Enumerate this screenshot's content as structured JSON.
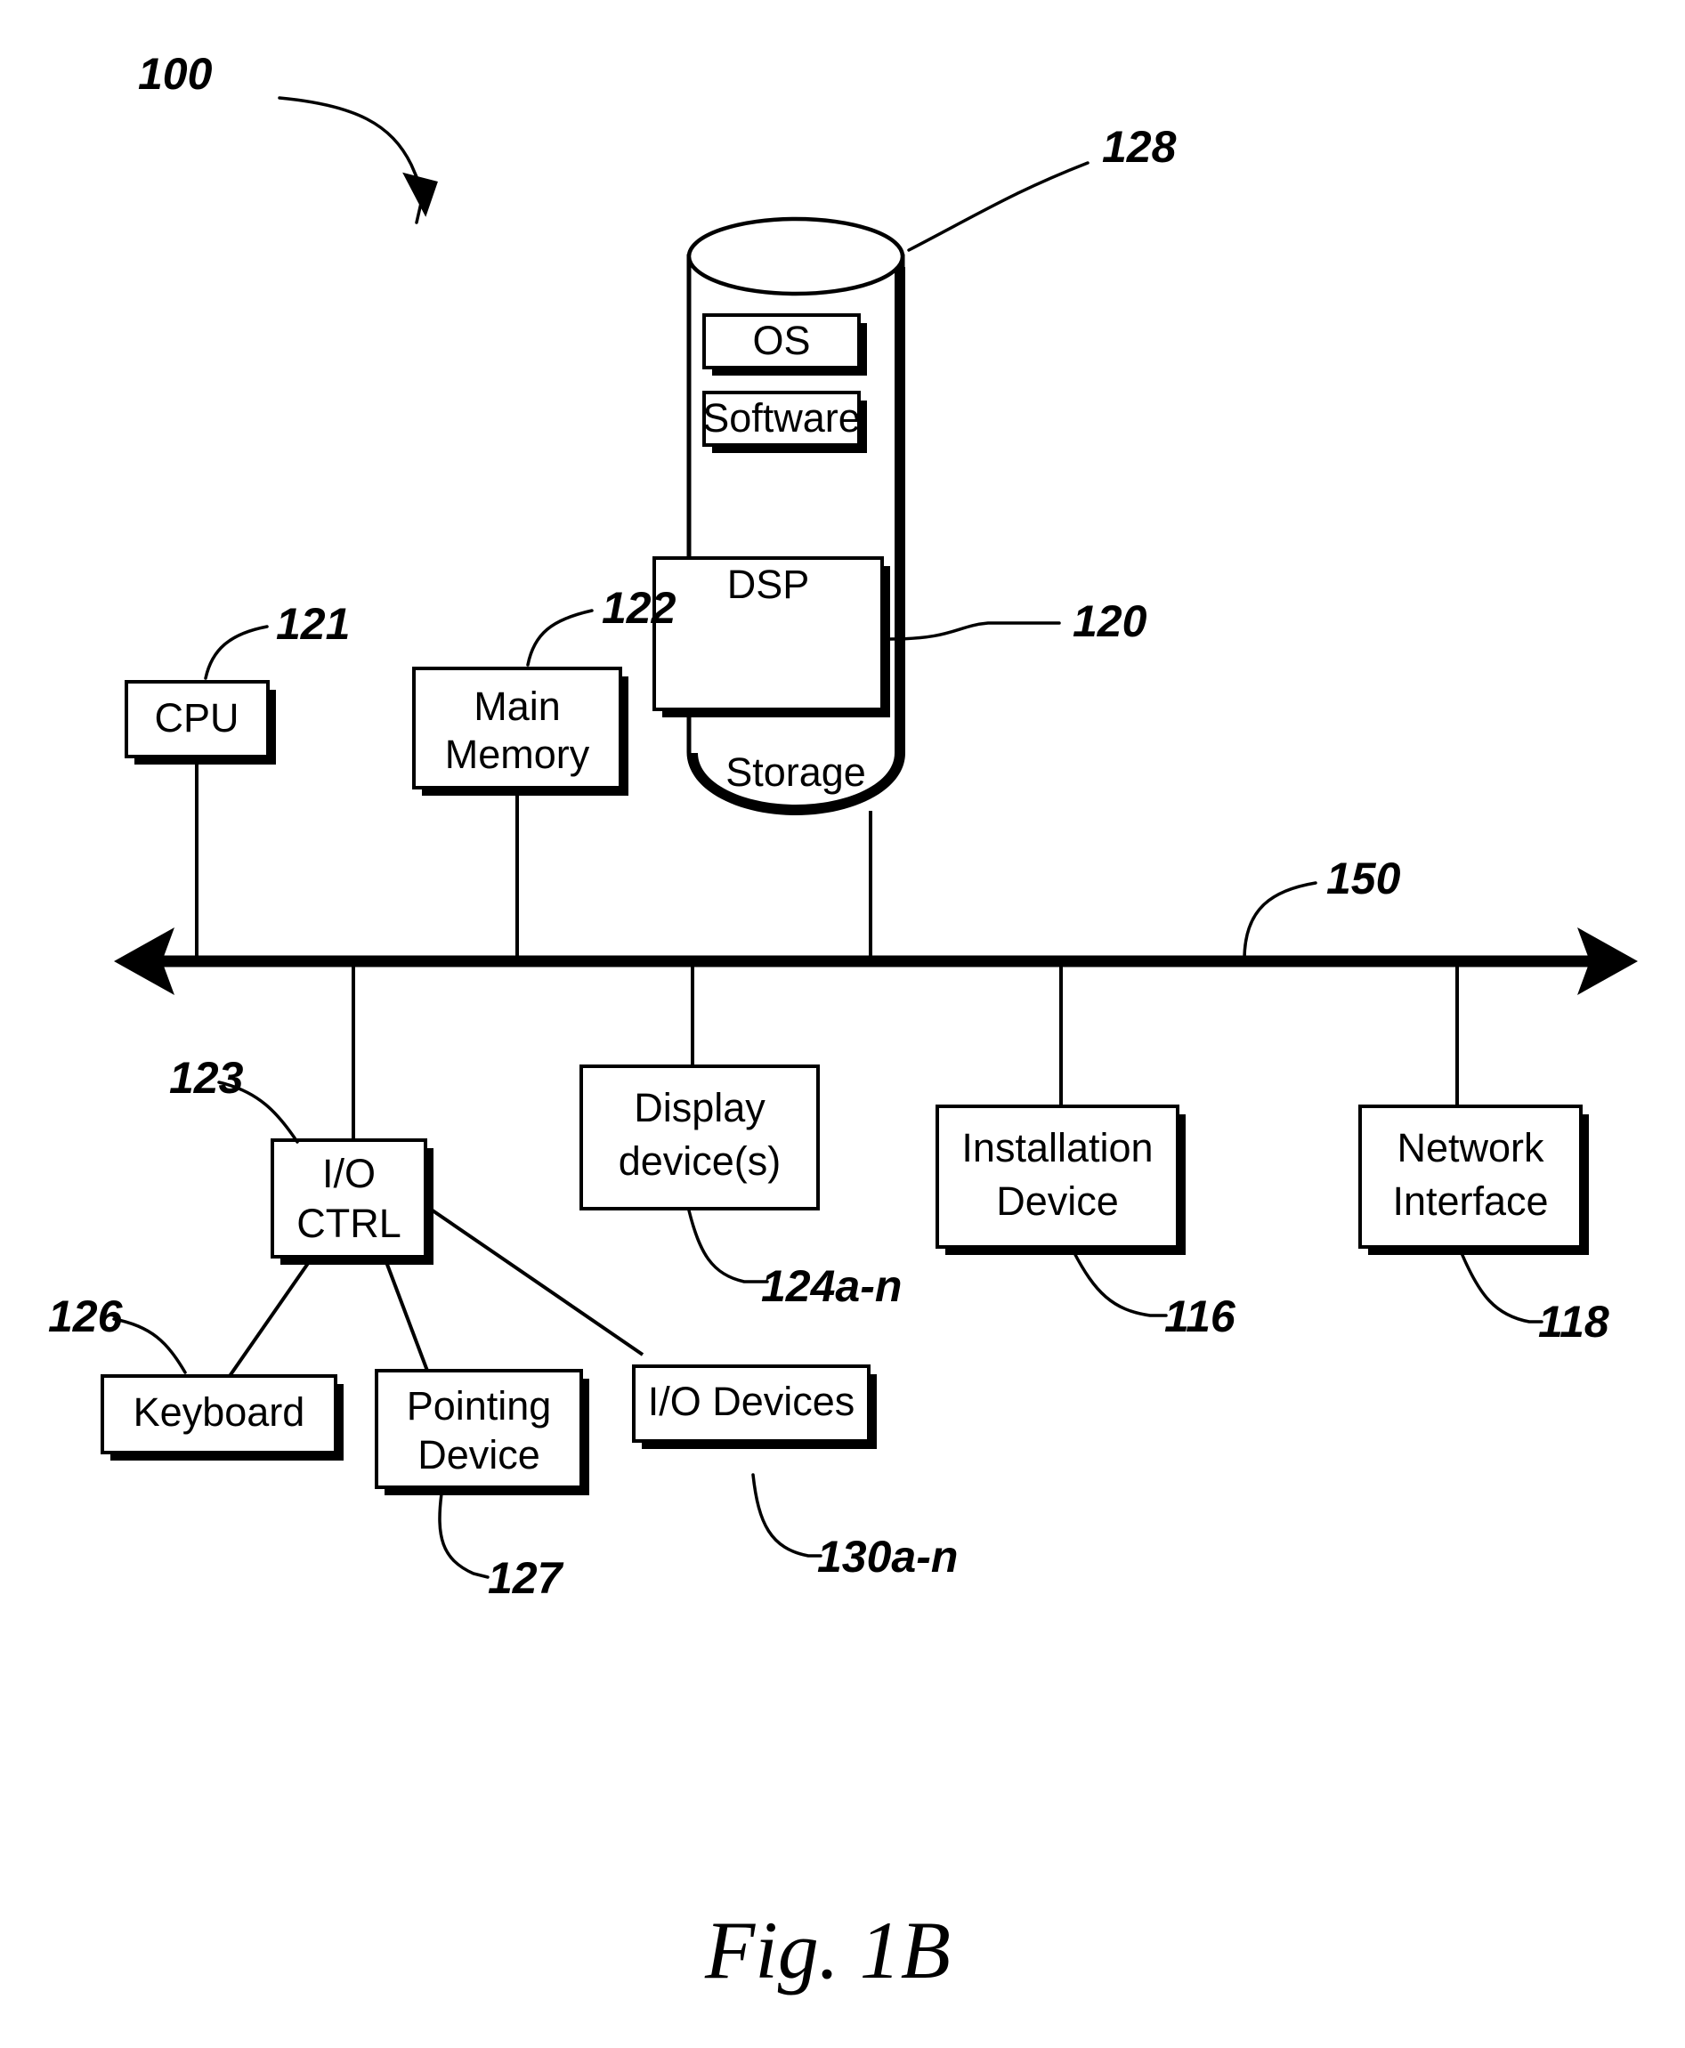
{
  "figure": {
    "caption": "Fig. 1B",
    "system_ref": "100"
  },
  "storage": {
    "label": "Storage",
    "ref": "128",
    "dsp_ref": "120",
    "contents": [
      {
        "label": "OS"
      },
      {
        "label": "Software"
      },
      {
        "label": "DSP"
      }
    ]
  },
  "bus": {
    "ref": "150"
  },
  "components": {
    "cpu": {
      "label": "CPU",
      "ref": "121"
    },
    "main_memory": {
      "label": "Main\nMemory",
      "line1": "Main",
      "line2": "Memory",
      "ref": "122"
    },
    "io_ctrl": {
      "label": "I/O CTRL",
      "line1": "I/O",
      "line2": "CTRL",
      "ref": "123"
    },
    "display": {
      "label": "Display device(s)",
      "line1": "Display",
      "line2": "device(s)",
      "ref": "124a-n"
    },
    "installation": {
      "label": "Installation Device",
      "line1": "Installation",
      "line2": "Device",
      "ref": "116"
    },
    "network": {
      "label": "Network Interface",
      "line1": "Network",
      "line2": "Interface",
      "ref": "118"
    },
    "keyboard": {
      "label": "Keyboard",
      "ref": "126"
    },
    "pointing": {
      "label": "Pointing Device",
      "line1": "Pointing",
      "line2": "Device",
      "ref": "127"
    },
    "io_devices": {
      "label": "I/O Devices",
      "ref": "130a-n"
    }
  },
  "colors": {
    "ink": "#000000",
    "paper": "#ffffff"
  }
}
